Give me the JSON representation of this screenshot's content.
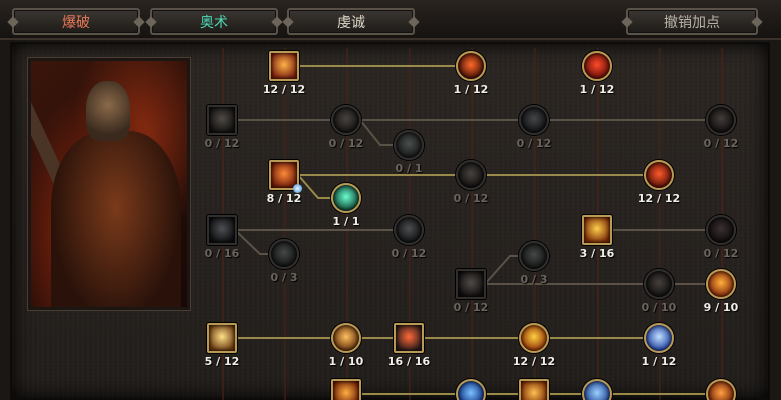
{
  "tabs": [
    {
      "label": "爆破",
      "color": "#e9795a",
      "active": true
    },
    {
      "label": "奥术",
      "color": "#4ed8b4",
      "active": false
    },
    {
      "label": "虔诚",
      "color": "#ddd6c8",
      "active": false
    }
  ],
  "undo_label": "撤销加点",
  "skills": [
    {
      "name": "skill-r1-a",
      "shape": "sq",
      "active": true,
      "icon": "fire-burst-icon",
      "colors": [
        "#ffb347",
        "#7a2010"
      ],
      "count": "12 / 12"
    },
    {
      "name": "skill-r1-b",
      "shape": "rd",
      "active": true,
      "icon": "fire-ring-icon",
      "colors": [
        "#ff6a2a",
        "#3a0a05"
      ],
      "count": "1 / 12"
    },
    {
      "name": "skill-r1-c",
      "shape": "rd",
      "active": true,
      "icon": "flame-icon",
      "colors": [
        "#ff4a2a",
        "#5a0a05"
      ],
      "count": "1 / 12"
    },
    {
      "name": "skill-r2-a",
      "shape": "sq",
      "active": false,
      "icon": "bullet-icon",
      "colors": [
        "#c08040",
        "#2a1a10"
      ],
      "count": "0 / 12"
    },
    {
      "name": "skill-r2-b",
      "shape": "rd",
      "active": false,
      "icon": "rifle-icon",
      "colors": [
        "#b07040",
        "#2a1a10"
      ],
      "count": "0 / 12"
    },
    {
      "name": "skill-r2-c",
      "shape": "rd",
      "active": false,
      "icon": "rune-icon",
      "colors": [
        "#5aa080",
        "#102a20"
      ],
      "count": "0 / 1"
    },
    {
      "name": "skill-r2-d",
      "shape": "rd",
      "active": false,
      "icon": "blade-icon",
      "colors": [
        "#7080a0",
        "#101828"
      ],
      "count": "0 / 12"
    },
    {
      "name": "skill-r2-e",
      "shape": "rd",
      "active": false,
      "icon": "claw-icon",
      "colors": [
        "#b06040",
        "#2a1008"
      ],
      "count": "0 / 12"
    },
    {
      "name": "skill-r3-a",
      "shape": "sq",
      "active": true,
      "icon": "fire-gun-icon",
      "colors": [
        "#ff8a3a",
        "#6a1a08"
      ],
      "count": "8 / 12",
      "spark": true
    },
    {
      "name": "skill-r3-b",
      "shape": "rd",
      "active": false,
      "icon": "shot-icon",
      "colors": [
        "#b07040",
        "#2a1008"
      ],
      "count": "0 / 12"
    },
    {
      "name": "skill-r3-c",
      "shape": "rd",
      "active": true,
      "icon": "flame-crest-icon",
      "colors": [
        "#ff5a2a",
        "#4a0a05"
      ],
      "count": "12 / 12"
    },
    {
      "name": "skill-r3-d",
      "shape": "rd",
      "active": true,
      "icon": "rune-glow-icon",
      "colors": [
        "#6affd0",
        "#0a3a2a"
      ],
      "count": "1 / 1"
    },
    {
      "name": "skill-r4-a",
      "shape": "sq",
      "active": false,
      "icon": "ice-icon",
      "colors": [
        "#8090c0",
        "#101830"
      ],
      "count": "0 / 16"
    },
    {
      "name": "skill-r4-b",
      "shape": "rd",
      "active": false,
      "icon": "frost-icon",
      "colors": [
        "#8090b0",
        "#101828"
      ],
      "count": "0 / 12"
    },
    {
      "name": "skill-r4-c",
      "shape": "rd",
      "active": false,
      "icon": "wisp-icon",
      "colors": [
        "#5a9070",
        "#102018"
      ],
      "count": "0 / 3"
    },
    {
      "name": "skill-r4-d",
      "shape": "sq",
      "active": true,
      "icon": "pillar-fire-icon",
      "colors": [
        "#ffd04a",
        "#7a2a08"
      ],
      "count": "3 / 16"
    },
    {
      "name": "skill-r4-e",
      "shape": "rd",
      "active": false,
      "icon": "blood-icon",
      "colors": [
        "#c04040",
        "#300808"
      ],
      "count": "0 / 12"
    },
    {
      "name": "skill-r5-a",
      "shape": "sq",
      "active": false,
      "icon": "hammer-icon",
      "colors": [
        "#c08050",
        "#2a1408"
      ],
      "count": "0 / 12"
    },
    {
      "name": "skill-r5-b",
      "shape": "rd",
      "active": false,
      "icon": "spirit-icon",
      "colors": [
        "#5a9070",
        "#102018"
      ],
      "count": "0 / 3"
    },
    {
      "name": "skill-r5-c",
      "shape": "rd",
      "active": false,
      "icon": "totem-icon",
      "colors": [
        "#b06a40",
        "#2a1008"
      ],
      "count": "0 / 10"
    },
    {
      "name": "skill-r5-d",
      "shape": "rd",
      "active": true,
      "icon": "inferno-icon",
      "colors": [
        "#ffb03a",
        "#7a2008"
      ],
      "count": "9 / 10"
    },
    {
      "name": "skill-r6-a",
      "shape": "sq",
      "active": true,
      "icon": "cannon-icon",
      "colors": [
        "#ffe08a",
        "#6a3a10"
      ],
      "count": "5 / 12"
    },
    {
      "name": "skill-r6-b",
      "shape": "rd",
      "active": true,
      "icon": "torch-icon",
      "colors": [
        "#ffc060",
        "#5a2a08"
      ],
      "count": "1 / 10"
    },
    {
      "name": "skill-r6-c",
      "shape": "sq",
      "active": true,
      "icon": "bomb-icon",
      "colors": [
        "#ff6a3a",
        "#2a1a18"
      ],
      "count": "16 / 16"
    },
    {
      "name": "skill-r6-d",
      "shape": "rd",
      "active": true,
      "icon": "explosion-icon",
      "colors": [
        "#ffd040",
        "#8a2a05"
      ],
      "count": "12 / 12"
    },
    {
      "name": "skill-r6-e",
      "shape": "rd",
      "active": true,
      "icon": "arcane-star-icon",
      "colors": [
        "#c0e0ff",
        "#1a3a9a"
      ],
      "count": "1 / 12"
    },
    {
      "name": "skill-r7-a",
      "shape": "sq",
      "active": true,
      "icon": "fire-wave-icon",
      "colors": [
        "#ffb040",
        "#6a1a05"
      ],
      "count": ""
    },
    {
      "name": "skill-r7-b",
      "shape": "rd",
      "active": true,
      "icon": "blue-orb-icon",
      "colors": [
        "#7ac0ff",
        "#0a2a7a"
      ],
      "count": ""
    },
    {
      "name": "skill-r7-c",
      "shape": "sq",
      "active": true,
      "icon": "blast-icon",
      "colors": [
        "#ffc050",
        "#7a2a05"
      ],
      "count": ""
    },
    {
      "name": "skill-r7-d",
      "shape": "rd",
      "active": true,
      "icon": "lightning-icon",
      "colors": [
        "#9ad0ff",
        "#1a3a8a"
      ],
      "count": ""
    },
    {
      "name": "skill-r7-e",
      "shape": "rd",
      "active": true,
      "icon": "ember-icon",
      "colors": [
        "#ffa040",
        "#6a1a05"
      ],
      "count": ""
    }
  ]
}
